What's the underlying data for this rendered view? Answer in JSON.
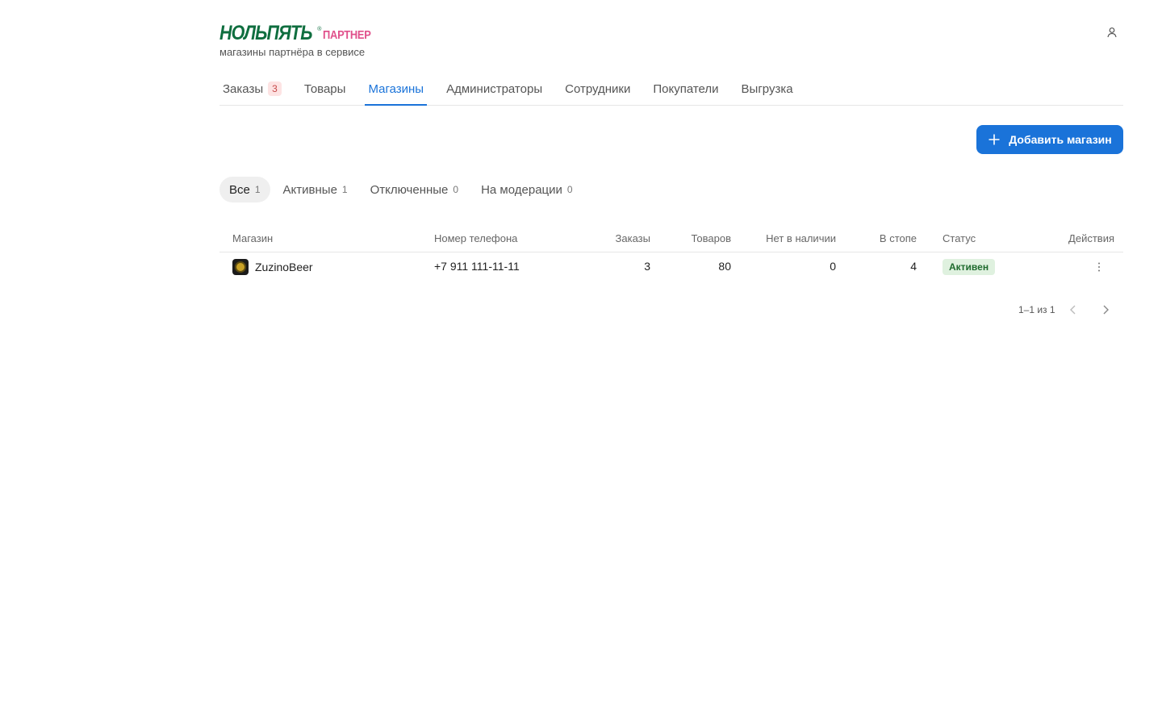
{
  "brand": {
    "logo_main": "НОЛЬПЯТЬ",
    "logo_sub": "ПАРТНЕР",
    "logo_reg": "®",
    "subtitle": "магазины партнёра в сервисе",
    "colors": {
      "logo_green": "#0f6e3f",
      "logo_pink": "#e0508b"
    }
  },
  "header": {
    "user_icon": "user-icon"
  },
  "tabs": [
    {
      "label": "Заказы",
      "badge": "3",
      "active": false
    },
    {
      "label": "Товары",
      "active": false
    },
    {
      "label": "Магазины",
      "active": true
    },
    {
      "label": "Администраторы",
      "active": false
    },
    {
      "label": "Сотрудники",
      "active": false
    },
    {
      "label": "Покупатели",
      "active": false
    },
    {
      "label": "Выгрузка",
      "active": false
    }
  ],
  "toolbar": {
    "add_label": "Добавить магазин",
    "accent": "#1a73d9"
  },
  "filters": [
    {
      "label": "Все",
      "count": "1",
      "active": true
    },
    {
      "label": "Активные",
      "count": "1",
      "active": false
    },
    {
      "label": "Отключенные",
      "count": "0",
      "active": false
    },
    {
      "label": "На модерации",
      "count": "0",
      "active": false
    }
  ],
  "table": {
    "columns": {
      "shop": "Магазин",
      "phone": "Номер телефона",
      "orders": "Заказы",
      "products": "Товаров",
      "out_of_stock": "Нет в наличии",
      "stopped": "В стопе",
      "status": "Статус",
      "actions": "Действия"
    },
    "rows": [
      {
        "shop": "ZuzinoBeer",
        "phone": "+7 911 111-11-11",
        "orders": "3",
        "products": "80",
        "out_of_stock": "0",
        "stopped": "4",
        "status": "Активен"
      }
    ]
  },
  "pagination": {
    "text": "1–1 из 1"
  }
}
